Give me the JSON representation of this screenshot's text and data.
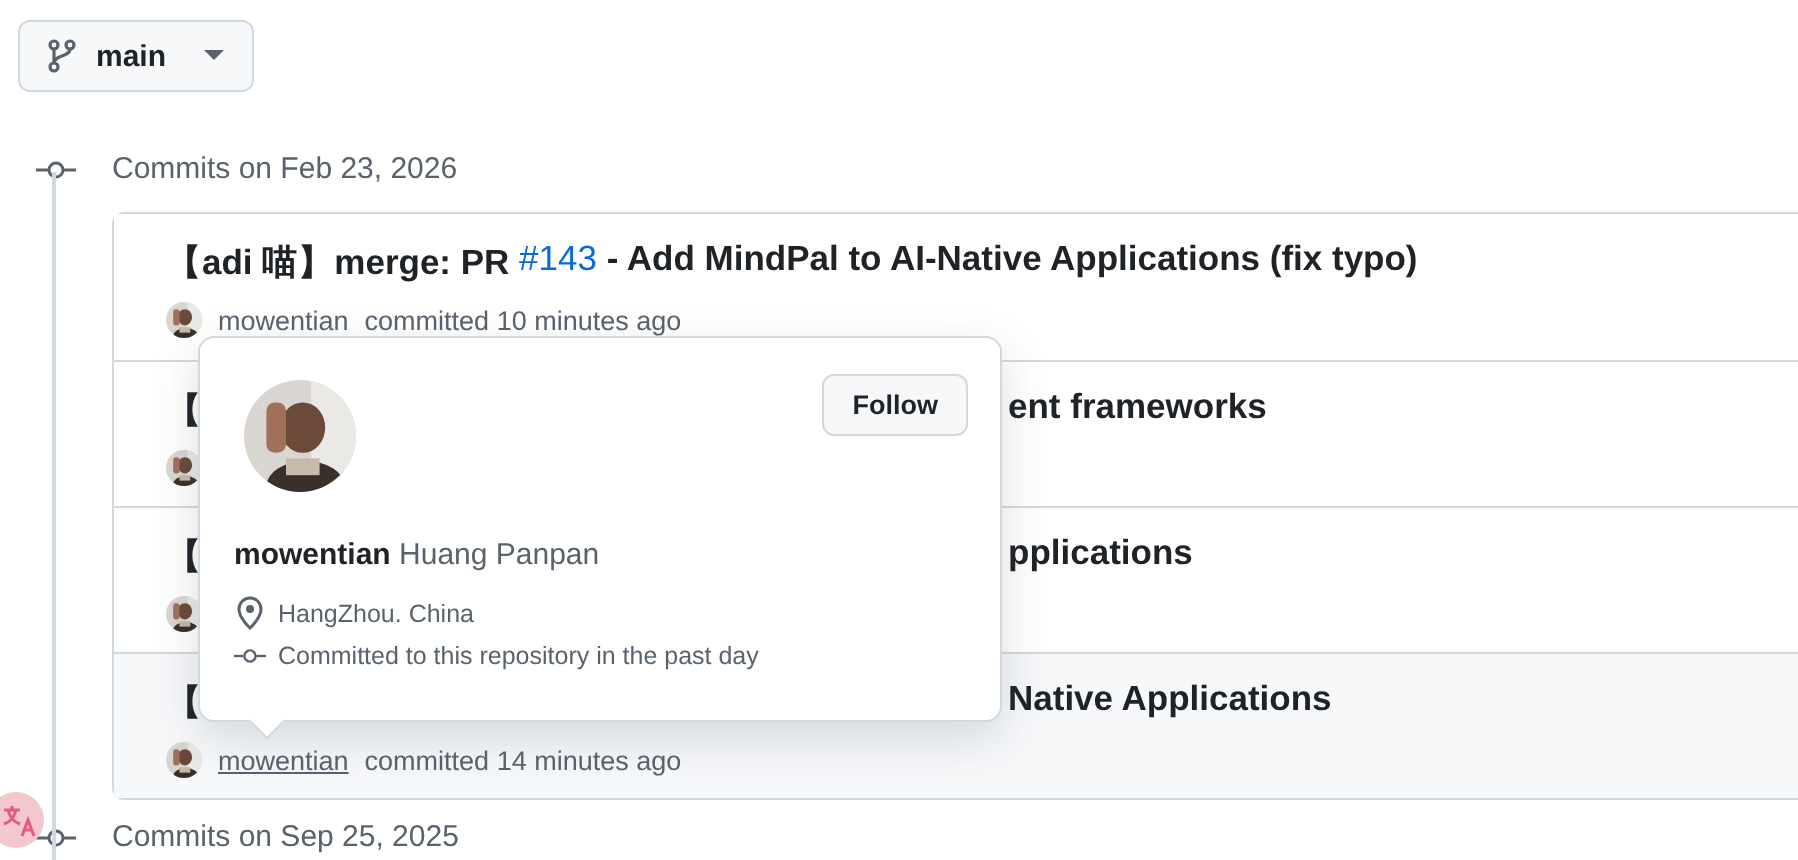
{
  "branch": {
    "name": "main"
  },
  "groups": [
    {
      "date": "Commits on Feb 23, 2026",
      "commits": [
        {
          "covered": false,
          "hovered": false,
          "title": [
            {
              "kind": "text",
              "text": "【adi 喵】merge: PR "
            },
            {
              "kind": "link",
              "text": "#143"
            },
            {
              "kind": "text",
              "text": " - Add MindPal to AI-Native Applications (fix typo)"
            }
          ],
          "author": "mowentian",
          "meta": "committed 10 minutes ago"
        },
        {
          "covered": true,
          "hovered": false,
          "title": [
            {
              "kind": "text",
              "text": "【"
            },
            {
              "kind": "text",
              "text": "ent frameworks"
            }
          ]
        },
        {
          "covered": true,
          "hovered": false,
          "title": [
            {
              "kind": "text",
              "text": "【"
            },
            {
              "kind": "text",
              "text": "pplications"
            }
          ]
        },
        {
          "covered": true,
          "hovered": true,
          "title": [
            {
              "kind": "text",
              "text": "【"
            },
            {
              "kind": "text",
              "text": "Native Applications"
            }
          ],
          "author": "mowentian",
          "meta": "committed 14 minutes ago"
        }
      ]
    },
    {
      "date": "Commits on Sep 25, 2025"
    }
  ],
  "hovercard": {
    "login": "mowentian",
    "name": "Huang Panpan",
    "location": "HangZhou. China",
    "note": "Committed to this repository in the past day",
    "follow": "Follow"
  }
}
